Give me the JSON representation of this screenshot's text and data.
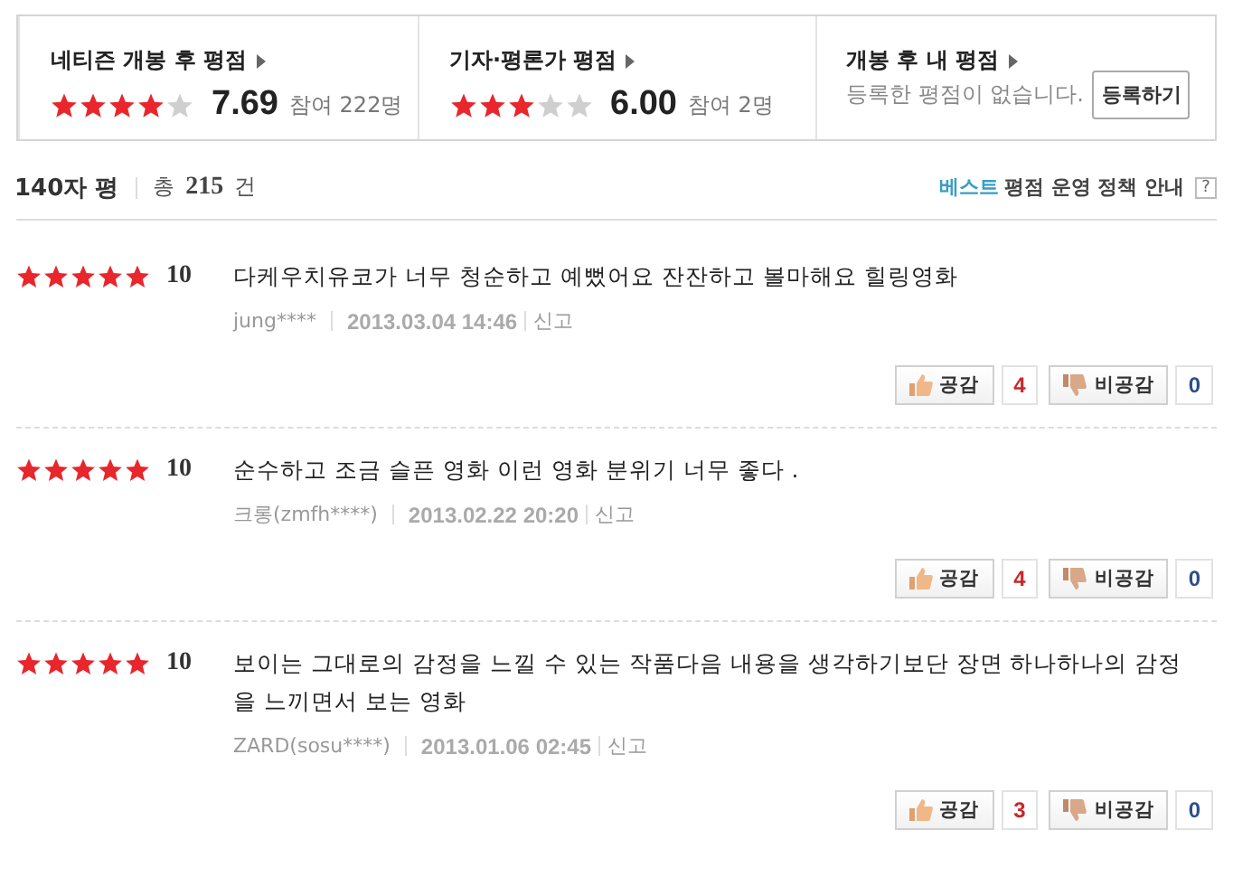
{
  "summary": [
    {
      "kind": "rating",
      "title": "네티즌 개봉 후 평점",
      "stars": 4,
      "score": "7.69",
      "participants": "참여 222명"
    },
    {
      "kind": "rating",
      "title": "기자·평론가 평점",
      "stars": 3,
      "score": "6.00",
      "participants": "참여 2명"
    },
    {
      "kind": "mine",
      "title": "개봉 후 내 평점",
      "message": "등록한 평점이 없습니다.",
      "button": "등록하기"
    }
  ],
  "header": {
    "title": "140자 평",
    "total_label": "총",
    "total": "215",
    "unit": "건",
    "best": "베스트",
    "policy": "평점 운영 정책 안내",
    "help": "?"
  },
  "reviews": [
    {
      "stars": 5,
      "score": "10",
      "text": "다케우치유코가 너무 청순하고 예뻤어요 잔잔하고 볼마해요 힐링영화",
      "author": "jung****",
      "date": "2013.03.04 14:46",
      "report": "신고",
      "like_label": "공감",
      "likes": "4",
      "dislike_label": "비공감",
      "dislikes": "0"
    },
    {
      "stars": 5,
      "score": "10",
      "text": "순수하고 조금 슬픈 영화 이런 영화 분위기 너무 좋다 .",
      "author": "크롱(zmfh****)",
      "date": "2013.02.22 20:20",
      "report": "신고",
      "like_label": "공감",
      "likes": "4",
      "dislike_label": "비공감",
      "dislikes": "0"
    },
    {
      "stars": 5,
      "score": "10",
      "text": "보이는 그대로의 감정을 느낄 수 있는 작품다음 내용을 생각하기보단 장면 하나하나의 감정을 느끼면서 보는 영화",
      "author": "ZARD(sosu****)",
      "date": "2013.01.06 02:45",
      "report": "신고",
      "like_label": "공감",
      "likes": "3",
      "dislike_label": "비공감",
      "dislikes": "0"
    }
  ]
}
